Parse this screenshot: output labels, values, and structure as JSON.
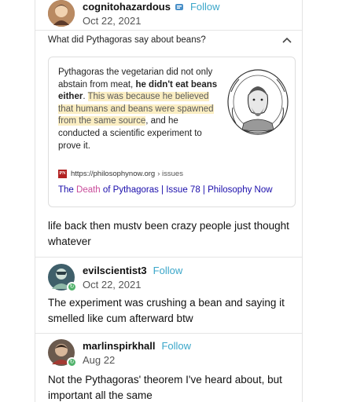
{
  "posts": [
    {
      "username": "cognitohazardous",
      "follow": "Follow",
      "date": "Oct 22, 2021"
    },
    {
      "username": "evilscientist3",
      "follow": "Follow",
      "date": "Oct 22, 2021",
      "text": "The experiment was crushing a bean and saying it smelled like cum afterward btw"
    },
    {
      "username": "marlinspirkhall",
      "follow": "Follow",
      "date": "Aug 22",
      "text": "Not the Pythagoras' theorem I've heard about, but important all the same"
    }
  ],
  "search_card": {
    "question": "What did Pythagoras say about beans?",
    "snippet": {
      "part1": "Pythagoras the vegetarian did not only abstain from meat, ",
      "bold": "he didn't eat beans either",
      "part2": ". ",
      "highlight": "This was because he believed that humans and beans were spawned from the same source",
      "part3": ", and he conducted a scientific experiment to prove it."
    },
    "source_logo": "PN",
    "source_url": "https://philosophynow.org",
    "source_path": "› issues",
    "result_title_pre": "The ",
    "result_title_highlight": "Death",
    "result_title_post": " of Pythagoras | Issue 78 | Philosophy Now"
  },
  "first_comment": "life back then mustv been crazy people just thought whatever",
  "colors": {
    "follow": "#3aa6c9",
    "highlight_bg": "#fbeec2",
    "link": "#1a0dab",
    "death_highlight": "#c94b9a"
  }
}
